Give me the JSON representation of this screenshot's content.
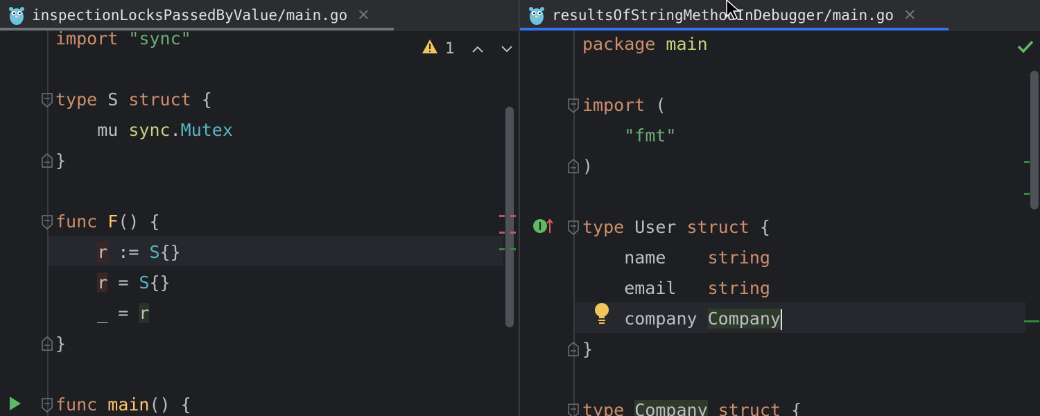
{
  "left_pane": {
    "tab": {
      "label": "inspectionLocksPassedByValue/main.go",
      "close": "✕"
    },
    "inspection": {
      "warning_count": "1"
    },
    "code": [
      {
        "tokens": [
          [
            "kw",
            "import"
          ],
          [
            "",
            " "
          ],
          [
            "str",
            "\"sync\""
          ]
        ]
      },
      {
        "tokens": []
      },
      {
        "tokens": [
          [
            "kw",
            "type"
          ],
          [
            "",
            " S "
          ],
          [
            "kw",
            "struct"
          ],
          [
            "",
            " {"
          ]
        ]
      },
      {
        "tokens": [
          [
            "",
            "    mu "
          ],
          [
            "pkg",
            "sync"
          ],
          [
            "",
            "."
          ],
          [
            "typ2",
            "Mutex"
          ]
        ]
      },
      {
        "tokens": [
          [
            "",
            "}"
          ]
        ]
      },
      {
        "tokens": []
      },
      {
        "tokens": [
          [
            "kw",
            "func"
          ],
          [
            "",
            " "
          ],
          [
            "fn",
            "F"
          ],
          [
            "",
            "() {"
          ]
        ]
      },
      {
        "tokens": [
          [
            "",
            "    "
          ],
          [
            "hl-r",
            "r"
          ],
          [
            "",
            " := "
          ],
          [
            "typ2",
            "S"
          ],
          [
            "",
            "{}"
          ]
        ]
      },
      {
        "tokens": [
          [
            "",
            "    "
          ],
          [
            "hl-r",
            "r"
          ],
          [
            "",
            " = "
          ],
          [
            "typ2",
            "S"
          ],
          [
            "",
            "{}"
          ]
        ]
      },
      {
        "tokens": [
          [
            "",
            "    _ = "
          ],
          [
            "hl-g",
            "r"
          ]
        ]
      },
      {
        "tokens": [
          [
            "",
            "}"
          ]
        ]
      },
      {
        "tokens": []
      },
      {
        "tokens": [
          [
            "kw",
            "func"
          ],
          [
            "",
            " "
          ],
          [
            "fn",
            "main"
          ],
          [
            "",
            "() {"
          ]
        ]
      }
    ]
  },
  "right_pane": {
    "tab": {
      "label": "resultsOfStringMethodInDebugger/main.go",
      "close": "✕"
    },
    "code": [
      {
        "tokens": [
          [
            "kw",
            "package"
          ],
          [
            "",
            " "
          ],
          [
            "pkg",
            "main"
          ]
        ]
      },
      {
        "tokens": []
      },
      {
        "tokens": [
          [
            "kw",
            "import"
          ],
          [
            "",
            " ("
          ]
        ]
      },
      {
        "tokens": [
          [
            "",
            "    "
          ],
          [
            "str",
            "\"fmt\""
          ]
        ]
      },
      {
        "tokens": [
          [
            "",
            ")"
          ]
        ]
      },
      {
        "tokens": []
      },
      {
        "tokens": [
          [
            "kw",
            "type"
          ],
          [
            "",
            " User "
          ],
          [
            "kw",
            "struct"
          ],
          [
            "",
            " {"
          ]
        ]
      },
      {
        "tokens": [
          [
            "",
            "    name    "
          ],
          [
            "kw",
            "string"
          ]
        ]
      },
      {
        "tokens": [
          [
            "",
            "    email   "
          ],
          [
            "kw",
            "string"
          ]
        ]
      },
      {
        "tokens": [
          [
            "",
            "    company "
          ],
          [
            "hl-co",
            "Company"
          ]
        ]
      },
      {
        "tokens": [
          [
            "",
            "}"
          ]
        ]
      },
      {
        "tokens": []
      },
      {
        "tokens": [
          [
            "kw",
            "type"
          ],
          [
            "",
            " "
          ],
          [
            "hl-co",
            "Company"
          ],
          [
            "",
            " "
          ],
          [
            "kw",
            "struct"
          ],
          [
            "",
            " {"
          ]
        ]
      }
    ]
  },
  "colors": {
    "accent": "#3574f0",
    "keyword": "#cf8e6d",
    "string": "#6aab73",
    "type": "#56b6c2",
    "function": "#ffc66d",
    "warning": "#f2c55c",
    "run": "#5fb865"
  },
  "icons": [
    "gopher-icon",
    "close-icon",
    "warning-icon",
    "chevron-up-icon",
    "chevron-down-icon",
    "fold-icon",
    "run-icon",
    "implements-icon",
    "bulb-icon",
    "checkmark-icon",
    "mouse-cursor-icon"
  ]
}
